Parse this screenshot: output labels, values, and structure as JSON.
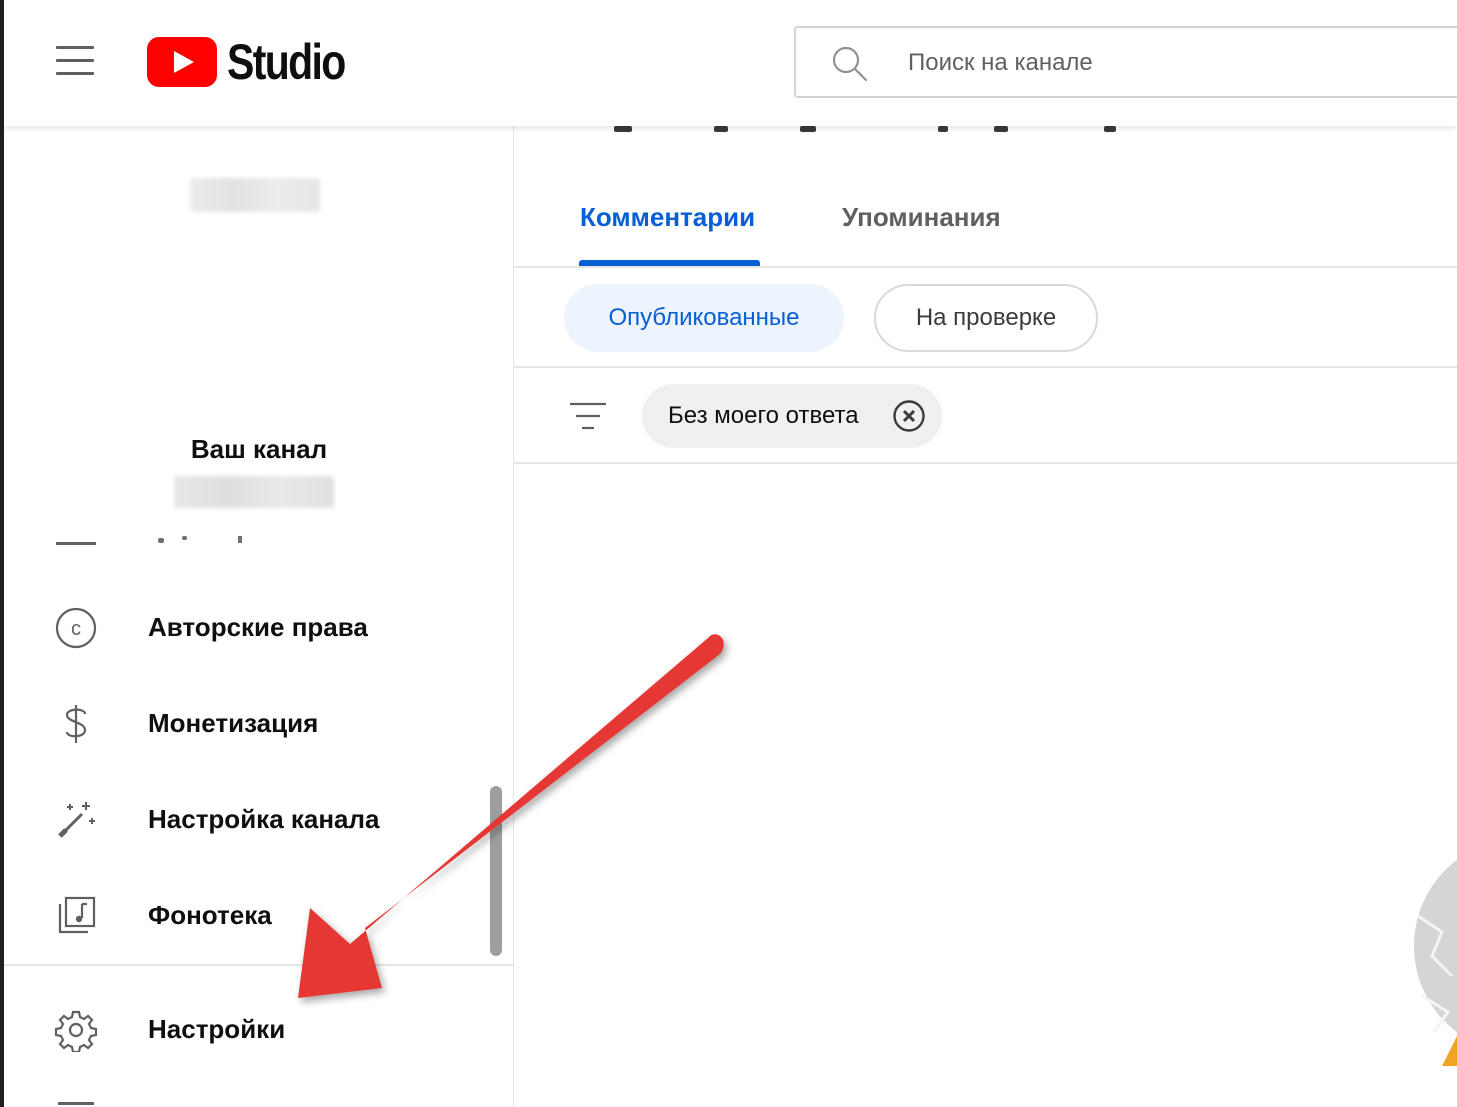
{
  "app": {
    "logo_text": "Studio",
    "brand_color": "#ff0000",
    "accent_color": "#065fd4"
  },
  "header": {
    "menu_icon": "hamburger-menu-icon",
    "search": {
      "icon": "search-icon",
      "placeholder": "Поиск на канале",
      "value": ""
    }
  },
  "sidebar": {
    "channel_title": "Ваш канал",
    "items": [
      {
        "icon": "copyright-icon",
        "label": "Авторские права"
      },
      {
        "icon": "dollar-icon",
        "label": "Монетизация"
      },
      {
        "icon": "magic-wand-icon",
        "label": "Настройка канала"
      },
      {
        "icon": "audio-library-icon",
        "label": "Фонотека"
      },
      {
        "icon": "gear-icon",
        "label": "Настройки"
      }
    ]
  },
  "main": {
    "tabs": [
      {
        "label": "Комментарии",
        "active": true
      },
      {
        "label": "Упоминания",
        "active": false
      }
    ],
    "chips": [
      {
        "label": "Опубликованные",
        "selected": true
      },
      {
        "label": "На проверке",
        "selected": false
      }
    ],
    "filter": {
      "icon": "filter-icon",
      "active_filter": "Без моего ответа",
      "remove_icon": "close-circle-icon"
    }
  },
  "annotation": {
    "arrow_color": "#e53935"
  }
}
